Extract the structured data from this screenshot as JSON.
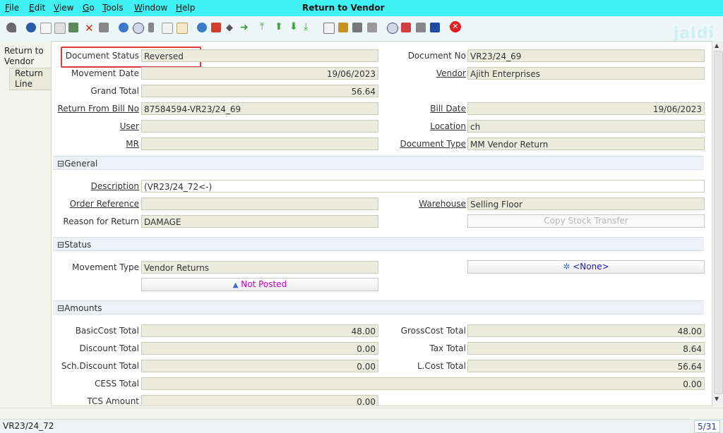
{
  "menu": {
    "file": "File",
    "edit": "Edit",
    "view": "View",
    "go": "Go",
    "tools": "Tools",
    "window": "Window",
    "help": "Help"
  },
  "window_title": "Return to Vendor",
  "logo_text": "jaldi",
  "tabs": {
    "main": "Return to Vendor",
    "sub": "Return Line"
  },
  "header": {
    "document_status_label": "Document Status",
    "document_status": "Reversed",
    "document_no_label": "Document No",
    "document_no": "VR23/24_69",
    "movement_date_label": "Movement Date",
    "movement_date": "19/06/2023",
    "vendor_label": "Vendor",
    "vendor": "Ajith Enterprises",
    "grand_total_label": "Grand Total",
    "grand_total": "56.64",
    "return_from_bill_label": "Return From Bill No",
    "return_from_bill": "87584594-VR23/24_69",
    "bill_date_label": "Bill Date",
    "bill_date": "19/06/2023",
    "user_label": "User",
    "user": "",
    "location_label": "Location",
    "location": "ch",
    "mr_label": "MR",
    "mr": "",
    "document_type_label": "Document Type",
    "document_type": "MM Vendor Return"
  },
  "general": {
    "title": "General",
    "description_label": "Description",
    "description": "(VR23/24_72<-)",
    "order_reference_label": "Order Reference",
    "order_reference": "",
    "warehouse_label": "Warehouse",
    "warehouse": "Selling Floor",
    "reason_label": "Reason for Return",
    "reason": "DAMAGE",
    "copy_stock_transfer": "Copy Stock Transfer"
  },
  "status_section": {
    "title": "Status",
    "movement_type_label": "Movement Type",
    "movement_type": "Vendor Returns",
    "none_button": "<None>",
    "not_posted_button": "Not Posted"
  },
  "amounts": {
    "title": "Amounts",
    "basic_cost_label": "BasicCost Total",
    "basic_cost": "48.00",
    "gross_cost_label": "GrossCost Total",
    "gross_cost": "48.00",
    "discount_label": "Discount Total",
    "discount": "0.00",
    "tax_label": "Tax Total",
    "tax": "8.64",
    "sch_discount_label": "Sch.Discount Total",
    "sch_discount": "0.00",
    "lcost_label": "L.Cost Total",
    "lcost": "56.64",
    "cess_label": "CESS Total",
    "cess": "0.00",
    "tcs_label": "TCS Amount",
    "tcs": "0.00"
  },
  "statusbar": {
    "left": "VR23/24_72",
    "right": "5/31"
  },
  "colors": {
    "menubar": "#3ff1f3",
    "field": "#ececde",
    "highlight": "#e03a3a",
    "not_posted": "#c800c8",
    "none_link": "#1a1aa8"
  }
}
